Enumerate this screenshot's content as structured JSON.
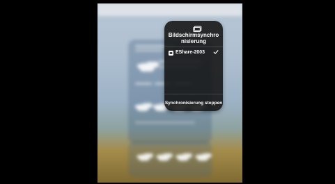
{
  "screen_mirroring": {
    "title": "Bildschirmsynchronisierung",
    "devices": [
      {
        "name": "EShare-2003",
        "selected": true,
        "icon": "appletv-icon"
      }
    ],
    "stop_button_label": "Synchronisierung stoppen",
    "icon": "screen-mirroring-icon",
    "check_icon": "checkmark-icon"
  }
}
